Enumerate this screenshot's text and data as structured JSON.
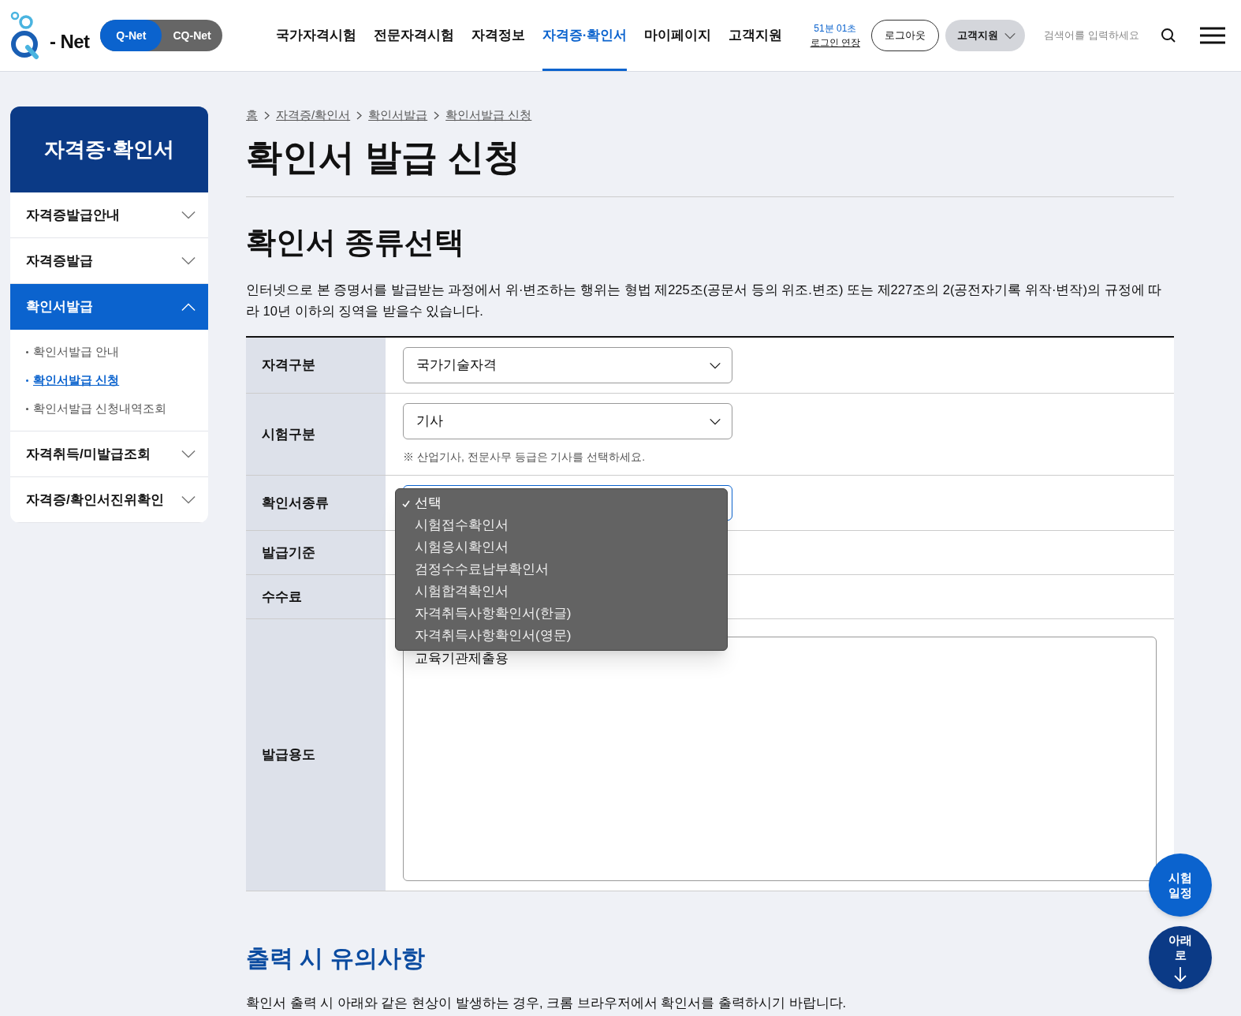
{
  "header": {
    "logo_text": "- Net",
    "site_switch": [
      {
        "label": "Q-Net",
        "selected": true
      },
      {
        "label": "CQ-Net",
        "selected": false
      }
    ],
    "nav": [
      {
        "label": "국가자격시험",
        "selected": false
      },
      {
        "label": "전문자격시험",
        "selected": false
      },
      {
        "label": "자격정보",
        "selected": false
      },
      {
        "label": "자격증·확인서",
        "selected": true
      },
      {
        "label": "마이페이지",
        "selected": false
      },
      {
        "label": "고객지원",
        "selected": false
      }
    ],
    "session_time": "51분 01초",
    "extend_login": "로그인 연장",
    "logout": "로그아웃",
    "support_menu": "고객지원",
    "search": {
      "placeholder": "검색어를 입력하세요"
    }
  },
  "sidebar": {
    "title": "자격증·확인서",
    "items": [
      {
        "label": "자격증발급안내",
        "expanded": false
      },
      {
        "label": "자격증발급",
        "expanded": false
      },
      {
        "label": "확인서발급",
        "expanded": true,
        "children": [
          {
            "label": "확인서발급 안내",
            "selected": false
          },
          {
            "label": "확인서발급 신청",
            "selected": true
          },
          {
            "label": "확인서발급 신청내역조회",
            "selected": false
          }
        ]
      },
      {
        "label": "자격취득/미발급조회",
        "expanded": false
      },
      {
        "label": "자격증/확인서진위확인",
        "expanded": false
      }
    ]
  },
  "breadcrumb": [
    "홈",
    "자격증/확인서",
    "확인서발급",
    "확인서발급 신청"
  ],
  "page_title": "확인서 발급 신청",
  "section_title": "확인서 종류선택",
  "warning": "인터넷으로 본 증명서를 발급받는 과정에서 위·변조하는 행위는 형법 제225조(공문서 등의 위조.변조) 또는 제227조의 2(공전자기록 위작·변작)의 규정에 따라 10년 이하의 징역을 받을수 있습니다.",
  "form": [
    {
      "label": "자격구분",
      "kind": "select",
      "value": "국가기술자격"
    },
    {
      "label": "시험구분",
      "kind": "select",
      "value": "기사",
      "note": "※ 산업기사, 전문사무 등급은 기사를 선택하세요."
    },
    {
      "label": "확인서종류",
      "kind": "select_open",
      "options": [
        {
          "label": "선택",
          "selected": true
        },
        {
          "label": "시험접수확인서",
          "selected": false
        },
        {
          "label": "시험응시확인서",
          "selected": false
        },
        {
          "label": "검정수수료납부확인서",
          "selected": false
        },
        {
          "label": "시험합격확인서",
          "selected": false
        },
        {
          "label": "자격취득사항확인서(한글)",
          "selected": false
        },
        {
          "label": "자격취득사항확인서(영문)",
          "selected": false
        }
      ]
    },
    {
      "label": "발급기준",
      "kind": "blank"
    },
    {
      "label": "수수료",
      "kind": "blank"
    },
    {
      "label": "발급용도",
      "kind": "textarea",
      "value": "교육기관제출용"
    }
  ],
  "notice_title": "출력 시 유의사항",
  "notice_text": "확인서 출력 시 아래와 같은 현상이 발생하는 경우, 크롬 브라우저에서 확인서를 출력하시기 바랍니다.",
  "floating": [
    {
      "label": "시험 일정",
      "kind": "schedule"
    },
    {
      "label": "아래로",
      "kind": "down"
    }
  ]
}
